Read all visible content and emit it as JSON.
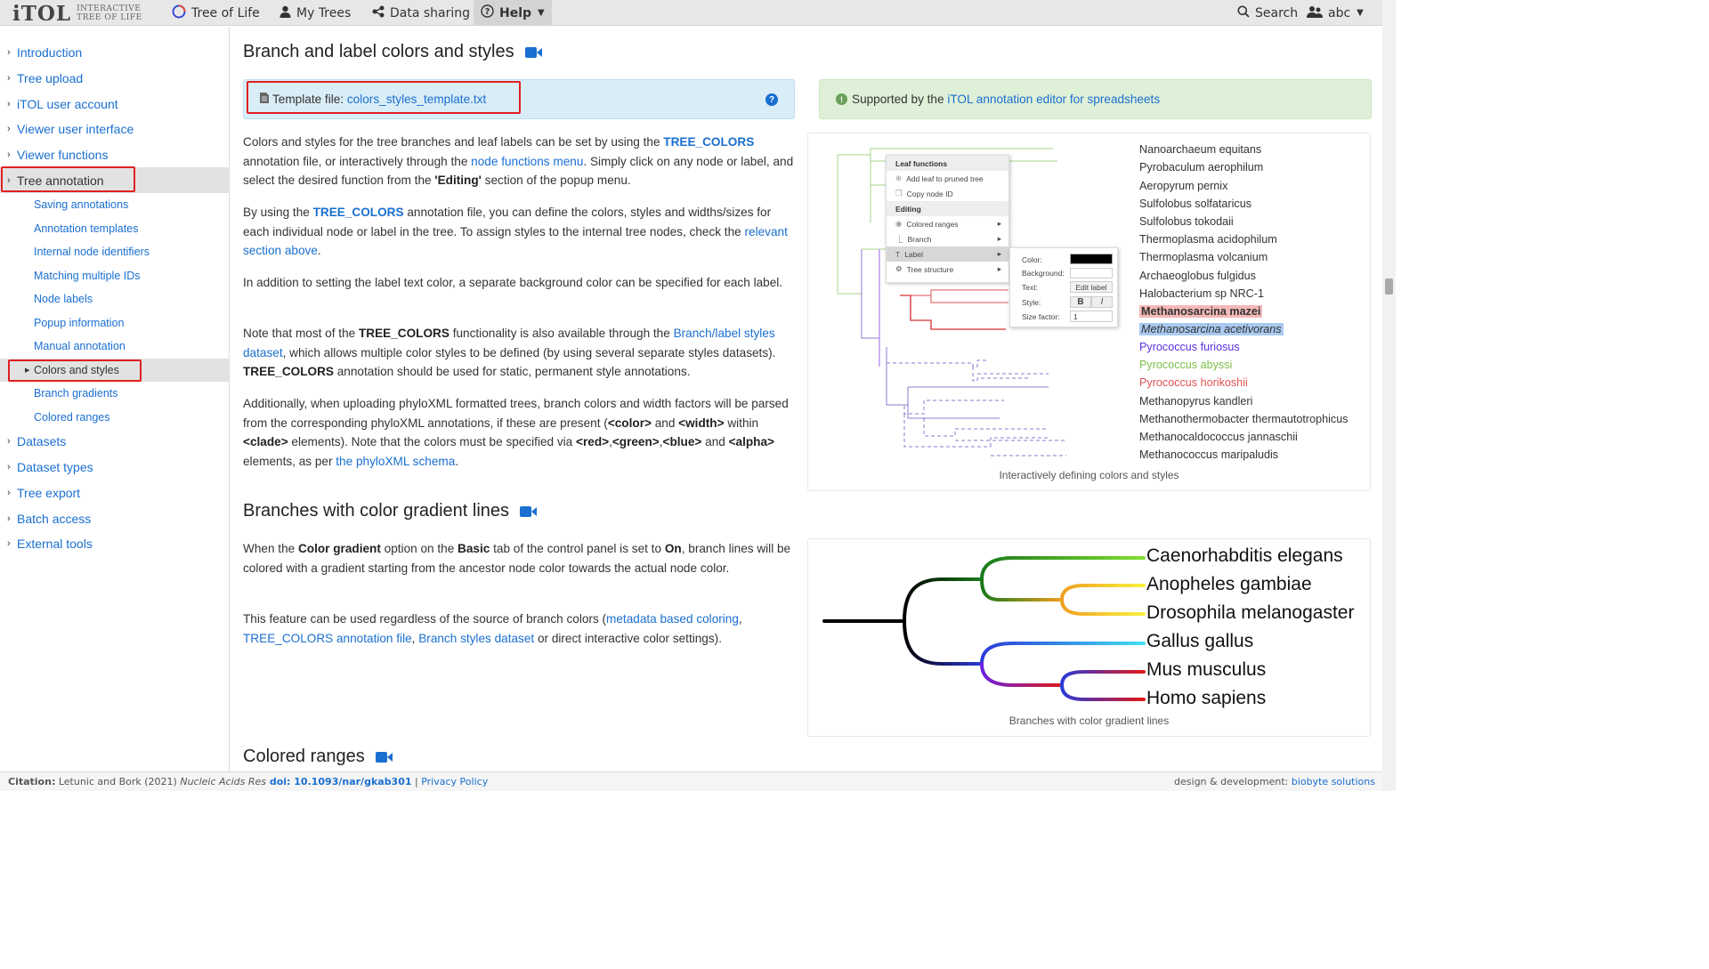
{
  "topbar": {
    "logo": "iTOL",
    "logo_sub1": "INTERACTIVE",
    "logo_sub2": "TREE OF LIFE",
    "nav": [
      "Tree of Life",
      "My Trees",
      "Data sharing",
      "Help"
    ],
    "search": "Search",
    "user": "abc"
  },
  "sidebar": {
    "top1": [
      "Introduction",
      "Tree upload",
      "iTOL user account",
      "Viewer user interface",
      "Viewer functions",
      "Tree annotation"
    ],
    "sub": [
      "Saving annotations",
      "Annotation templates",
      "Internal node identifiers",
      "Matching multiple IDs",
      "Node labels",
      "Popup information",
      "Manual annotation",
      "Colors and styles",
      "Branch gradients",
      "Colored ranges"
    ],
    "top2": [
      "Datasets",
      "Dataset types",
      "Tree export",
      "Batch access",
      "External tools"
    ]
  },
  "section1": {
    "title": "Branch and label colors and styles",
    "template_label": "Template file: ",
    "template_link": "colors_styles_template.txt",
    "support_text": "Supported by the ",
    "support_link": "iTOL annotation editor for spreadsheets",
    "p1": {
      "a": "Colors and styles for the tree branches and leaf labels can be set by using the ",
      "b": "TREE_COLORS",
      "c": "annotation file, or interactively through the ",
      "d": "node functions menu",
      "e": ". Simply click on any node or label, and select the desired function from the ",
      "f": "'Editing'",
      "g": " section of the popup menu."
    },
    "p2": {
      "a": "By using the ",
      "b": "TREE_COLORS",
      "c": " annotation file, you can define the colors, styles and widths/sizes for each individual node or label in the tree. To assign styles to the internal tree nodes, check the ",
      "d": "relevant section above",
      "e": "."
    },
    "p3": "In addition to setting the label text color, a separate background color can be specified for each label.",
    "p4": {
      "a": "Note that most of the ",
      "b": "TREE_COLORS",
      "c": " functionality is also available through the ",
      "d": "Branch/label styles dataset",
      "e": ", which allows multiple color styles to be defined (by using several separate styles datasets). ",
      "f": "TREE_COLORS",
      "g": " annotation should be used for static, permanent style annotations."
    },
    "p5": {
      "a": "Additionally, when uploading phyloXML formatted trees, branch colors and width factors will be parsed from the corresponding phyloXML annotations, if these are present (",
      "b": "<color>",
      "c": " and ",
      "d": "<width>",
      "e": " within ",
      "f": "<clade>",
      "g": " elements). Note that the colors must be specified via ",
      "h": "<red>",
      "i": ",",
      "j": "<green>",
      "k": ",",
      "l": "<blue>",
      "m": " and ",
      "n": "<alpha>",
      "o": " elements, as per ",
      "p": "the phyloXML schema",
      "q": "."
    },
    "figure_caption": "Interactively defining colors and styles",
    "taxa": [
      "Nanoarchaeum equitans",
      "Pyrobaculum aerophilum",
      "Aeropyrum pernix",
      "Sulfolobus solfataricus",
      "Sulfolobus tokodaii",
      "Thermoplasma acidophilum",
      "Thermoplasma volcanium",
      "Archaeoglobus fulgidus",
      "Halobacterium sp NRC-1",
      "Methanosarcina mazei",
      "Methanosarcina acetivorans",
      "Pyrococcus furiosus",
      "Pyrococcus abyssi",
      "Pyrococcus horikoshii",
      "Methanopyrus kandleri",
      "Methanothermobacter thermautotrophicus",
      "Methanocaldococcus jannaschii",
      "Methanococcus maripaludis"
    ],
    "popup": {
      "leaf_header": "Leaf functions",
      "add_leaf": "Add leaf to pruned tree",
      "copy_id": "Copy node ID",
      "edit_header": "Editing",
      "colored_ranges": "Colored ranges",
      "branch": "Branch",
      "label": "Label",
      "tree_structure": "Tree structure"
    },
    "subpopup": {
      "color": "Color:",
      "background": "Background:",
      "text": "Text:",
      "edit_label": "Edit label",
      "style": "Style:",
      "bold": "B",
      "italic": "I",
      "size_factor": "Size factor:",
      "size_value": "1"
    }
  },
  "section2": {
    "title": "Branches with color gradient lines",
    "p1": {
      "a": "When the ",
      "b": "Color gradient",
      "c": " option on the ",
      "d": "Basic",
      "e": " tab of the control panel is set to ",
      "f": "On",
      "g": ", branch lines will be colored with a gradient starting from the ancestor node color towards the actual node color."
    },
    "p2": {
      "a": "This feature can be used regardless of the source of branch colors (",
      "b": "metadata based coloring",
      "c": ", ",
      "d": "TREE_COLORS annotation file",
      "e": ", ",
      "f": "Branch styles dataset",
      "g": " or direct interactive color settings)."
    },
    "figure_caption": "Branches with color gradient lines",
    "taxa": [
      "Caenorhabditis elegans",
      "Anopheles gambiae",
      "Drosophila melanogaster",
      "Gallus gallus",
      "Mus musculus",
      "Homo sapiens"
    ]
  },
  "section3": {
    "title": "Colored ranges"
  },
  "footer": {
    "citation_label": "Citation:",
    "authors": " Letunic and Bork (2021) ",
    "journal": "Nucleic Acids Res",
    "doi": " doi: 10.1093/nar/gkab301",
    "sep": " | ",
    "privacy": "Privacy Policy",
    "design": "design & development: ",
    "design_link": "biobyte solutions"
  },
  "colors": {
    "accent": "#1a6fd0",
    "info_bg": "#d9edf7",
    "success_bg": "#dff0d8",
    "highlight": "#e02020"
  }
}
